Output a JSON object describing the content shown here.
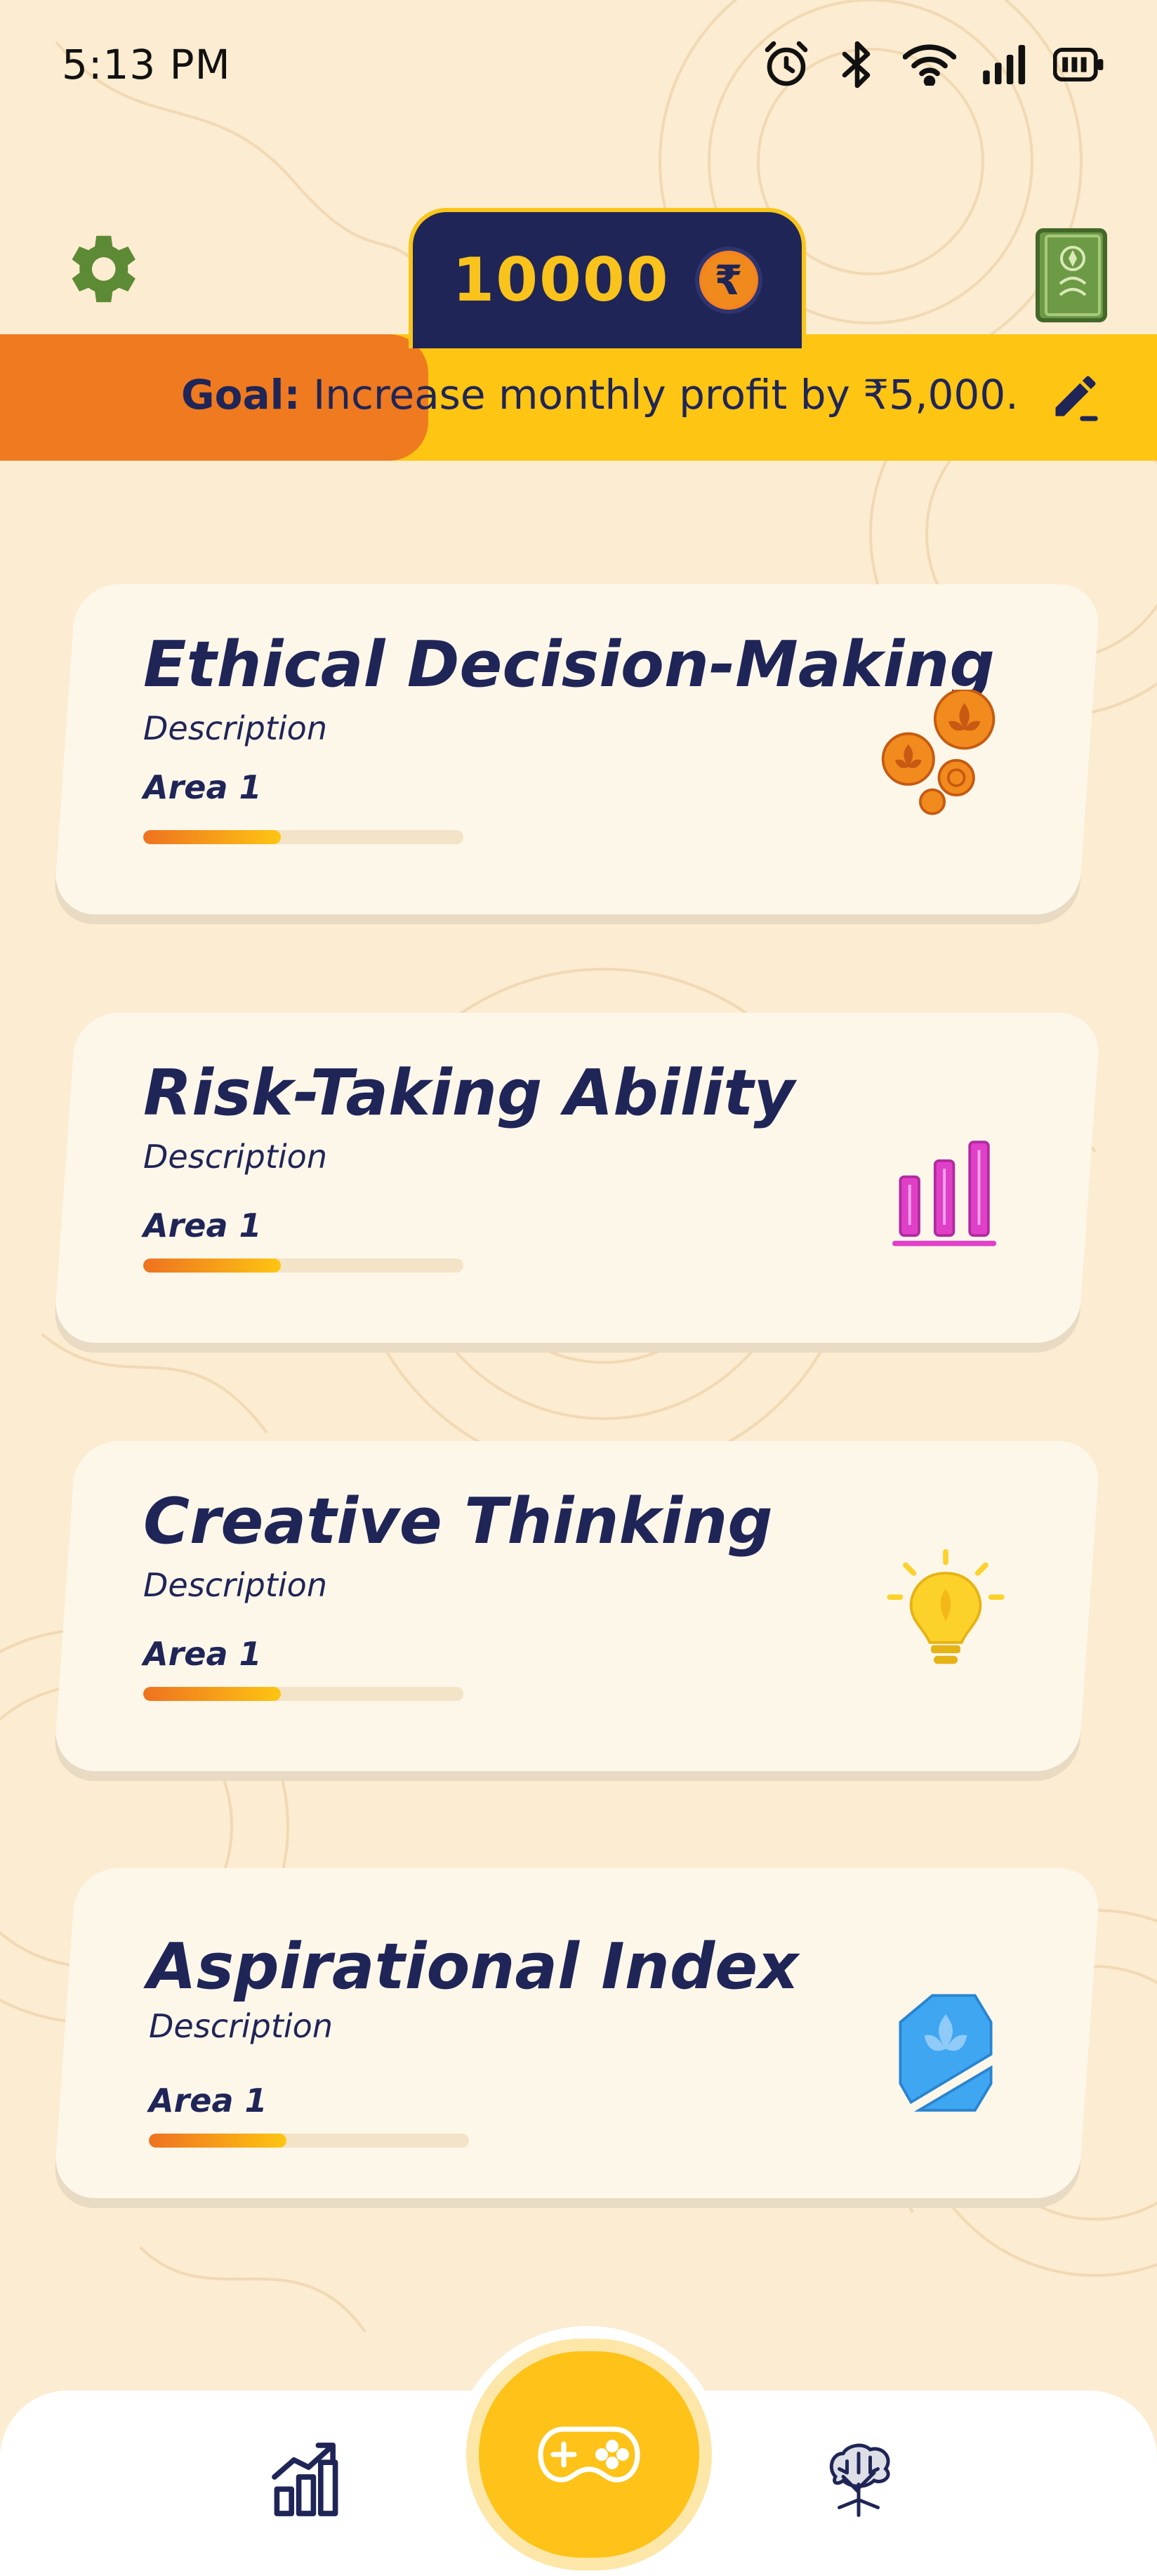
{
  "status_bar": {
    "time": "5:13 PM",
    "icons": [
      "alarm-icon",
      "bluetooth-icon",
      "wifi-icon",
      "signal-icon",
      "battery-icon"
    ]
  },
  "header": {
    "coins": "10000",
    "currency_symbol": "₹",
    "goal_label": "Goal:",
    "goal_text": " Increase monthly profit by ₹5,000.",
    "goal_progress_fraction": 0.37
  },
  "cards": [
    {
      "title": "Ethical Decision-Making",
      "description": "Description",
      "area": "Area 1",
      "icon": "coins-icon",
      "progress": 0.43
    },
    {
      "title": "Risk-Taking Ability",
      "description": "Description",
      "area": "Area 1",
      "icon": "bar-chart-icon",
      "progress": 0.43
    },
    {
      "title": "Creative Thinking",
      "description": "Description",
      "area": "Area 1",
      "icon": "lightbulb-icon",
      "progress": 0.43
    },
    {
      "title": "Aspirational Index",
      "description": "Description",
      "area": "Area 1",
      "icon": "shield-icon",
      "progress": 0.43
    }
  ],
  "bottom_nav": {
    "items": [
      "stats-icon",
      "gamepad-icon",
      "tree-icon"
    ]
  },
  "colors": {
    "background": "#fcecd1",
    "navy": "#1f2557",
    "yellow": "#fec512",
    "orange": "#ef7a1f",
    "green": "#5d8a35",
    "magenta": "#e040c8",
    "blue": "#3fa6f2"
  }
}
